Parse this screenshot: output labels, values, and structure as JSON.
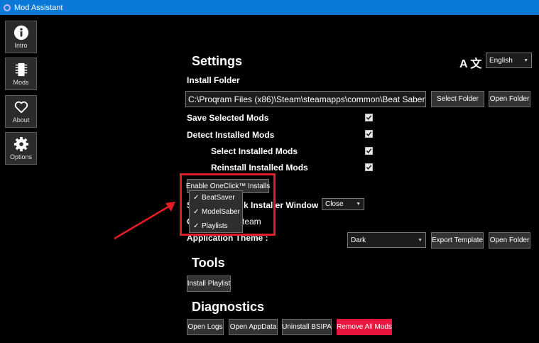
{
  "window": {
    "title": "Mod Assistant"
  },
  "sidebar": {
    "items": [
      {
        "label": "Intro"
      },
      {
        "label": "Mods"
      },
      {
        "label": "About"
      },
      {
        "label": "Options"
      }
    ]
  },
  "settings": {
    "heading": "Settings",
    "language": {
      "glyph": "A 文",
      "selected": "English"
    },
    "install_folder": {
      "label": "Install Folder",
      "path": "C:\\Proqram Files (x86)\\Steam\\steamapps\\common\\Beat Saber",
      "select_button": "Select Folder",
      "open_button": "Open Folder"
    },
    "options": [
      {
        "label": "Save Selected Mods",
        "checked": true
      },
      {
        "label": "Detect Installed Mods",
        "checked": true
      },
      {
        "label": "Select Installed Mods",
        "checked": true
      },
      {
        "label": "Reinstall Installed Mods",
        "checked": true
      }
    ],
    "oneclick": {
      "button": "Enable OneClick™ Installs",
      "menu": [
        "BeatSaver",
        "ModelSaber",
        "Playlists"
      ]
    },
    "installer_window": {
      "label_left": "S",
      "label_right": "k Installer Window",
      "selected": "Close"
    },
    "game_type": {
      "label_left": "G",
      "label_right": "team"
    },
    "theme": {
      "label": "Application Theme :",
      "selected": "Dark",
      "export_button": "Export Template",
      "open_button": "Open Folder"
    }
  },
  "tools": {
    "heading": "Tools",
    "install_playlist": "Install Playlist"
  },
  "diagnostics": {
    "heading": "Diagnostics",
    "buttons": [
      "Open Logs",
      "Open AppData",
      "Uninstall BSIPA",
      "Remove All Mods"
    ]
  },
  "colors": {
    "titlebar": "#0a78d7",
    "danger": "#e8163f",
    "annotation": "#e21b24"
  }
}
